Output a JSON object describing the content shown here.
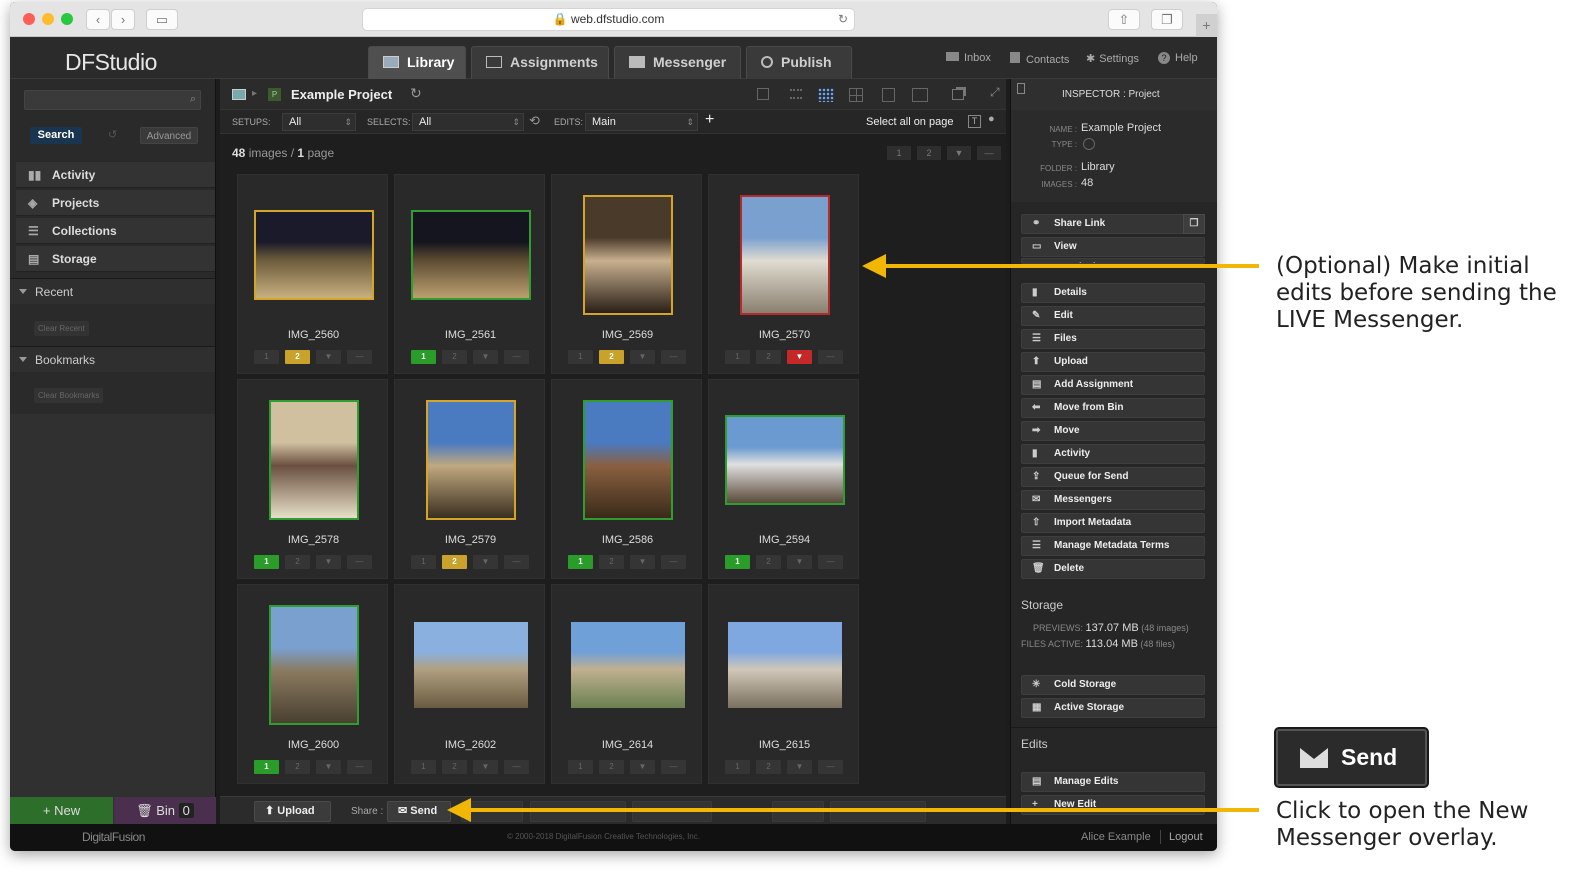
{
  "browser": {
    "url": "web.dfstudio.com"
  },
  "app": {
    "logo": "DFStudio",
    "tabs": [
      {
        "label": "Library",
        "active": true
      },
      {
        "label": "Assignments",
        "active": false
      },
      {
        "label": "Messenger",
        "active": false
      },
      {
        "label": "Publish",
        "active": false
      }
    ],
    "top_links": [
      "Inbox",
      "Contacts",
      "Settings",
      "Help"
    ]
  },
  "left": {
    "search_button": "Search",
    "advanced_button": "Advanced",
    "nav": [
      "Activity",
      "Projects",
      "Collections",
      "Storage"
    ],
    "recent": "Recent",
    "clear_recent": "Clear Recent",
    "bookmarks": "Bookmarks",
    "clear_bookmarks": "Clear Bookmarks",
    "new_button": "+ New",
    "bin_label": "Bin",
    "bin_count": "0"
  },
  "center": {
    "project_title": "Example Project",
    "setups_label": "SETUPS:",
    "setups_value": "All",
    "selects_label": "SELECTS:",
    "selects_value": "All",
    "edits_label": "EDITS:",
    "edits_value": "Main",
    "select_all": "Select all on page",
    "images_count": "48",
    "images_text": "images /",
    "page_count": "1",
    "page_text": "page",
    "pager": [
      "1",
      "2"
    ],
    "images": [
      {
        "name": "IMG_2560",
        "frame": "y",
        "rating": "2",
        "orient": "land"
      },
      {
        "name": "IMG_2561",
        "frame": "g",
        "rating": "1",
        "orient": "land"
      },
      {
        "name": "IMG_2569",
        "frame": "y",
        "rating": "2",
        "orient": "port"
      },
      {
        "name": "IMG_2570",
        "frame": "r",
        "rating": "x",
        "orient": "port"
      },
      {
        "name": "IMG_2578",
        "frame": "g",
        "rating": "1",
        "orient": "port"
      },
      {
        "name": "IMG_2579",
        "frame": "y",
        "rating": "2",
        "orient": "port"
      },
      {
        "name": "IMG_2586",
        "frame": "g",
        "rating": "1",
        "orient": "port"
      },
      {
        "name": "IMG_2594",
        "frame": "g",
        "rating": "1",
        "orient": "land"
      },
      {
        "name": "IMG_2600",
        "frame": "g",
        "rating": "1",
        "orient": "port"
      },
      {
        "name": "IMG_2602",
        "frame": "n",
        "rating": "0",
        "orient": "land"
      },
      {
        "name": "IMG_2614",
        "frame": "n",
        "rating": "0",
        "orient": "land"
      },
      {
        "name": "IMG_2615",
        "frame": "n",
        "rating": "0",
        "orient": "land"
      }
    ],
    "upload_button": "Upload",
    "share_label": "Share :",
    "send_button": "Send"
  },
  "inspector": {
    "title": "INSPECTOR : Project",
    "name_label": "NAME :",
    "name_value": "Example Project",
    "type_label": "TYPE :",
    "folder_label": "FOLDER :",
    "folder_value": "Library",
    "images_label": "IMAGES :",
    "images_value": "48",
    "buttons": [
      "Share Link",
      "View",
      "Permissions",
      "Details",
      "Edit",
      "Files",
      "Upload",
      "Add Assignment",
      "Move from Bin",
      "Move",
      "Activity",
      "Queue for Send",
      "Messengers",
      "Import Metadata",
      "Manage Metadata Terms",
      "Delete"
    ],
    "storage_title": "Storage",
    "previews_label": "PREVIEWS:",
    "previews_value": "137.07 MB",
    "previews_note": "(48 images)",
    "files_label": "FILES ACTIVE:",
    "files_value": "113.04 MB",
    "files_note": "(48 files)",
    "storage_buttons": [
      "Cold Storage",
      "Active Storage"
    ],
    "edits_title": "Edits",
    "edits_buttons": [
      "Manage Edits",
      "New Edit"
    ]
  },
  "footer": {
    "brand": "DigitalFusion",
    "copyright": "© 2000-2018 DigitalFusion Creative Technologies, Inc.",
    "user": "Alice Example",
    "logout": "Logout"
  },
  "annotations": {
    "top": "(Optional) Make initial edits before sending the LIVE Messenger.",
    "bottom": "Click to open the New Messenger overlay.",
    "send_callout": "Send"
  },
  "colors": {
    "arrow": "#f2b705",
    "select_green": "#2a9c2a",
    "select_gold": "#c8a22a",
    "reject_red": "#c52828"
  }
}
